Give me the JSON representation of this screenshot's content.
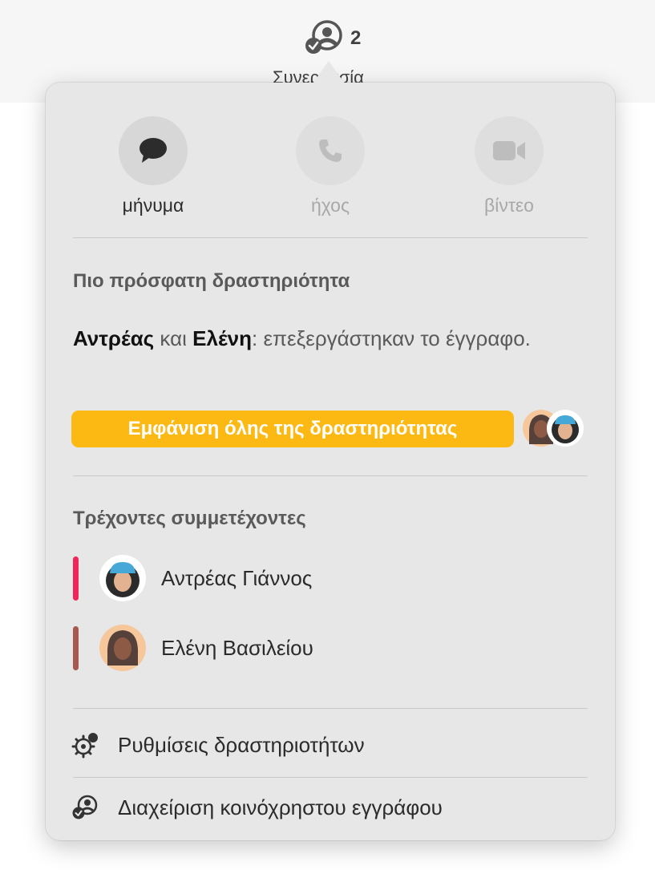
{
  "toolbar": {
    "collaborator_count": "2",
    "collab_label": "Συνεργασία"
  },
  "communication": {
    "message_label": "μήνυμα",
    "audio_label": "ήχος",
    "video_label": "βίντεο"
  },
  "recent_activity": {
    "title": "Πιο πρόσφατη δραστηριότητα",
    "name1": "Αντρέας",
    "conjunction": " και ",
    "name2": "Ελένη",
    "rest": ": επεξεργάστηκαν το έγγραφο.",
    "show_all_label": "Εμφάνιση όλης της δραστηριότητας"
  },
  "participants": {
    "title": "Τρέχοντες συμμετέχοντες",
    "items": [
      {
        "name": "Αντρέας Γιάννος",
        "color": "#f0255a"
      },
      {
        "name": "Ελένη Βασιλείου",
        "color": "#a65a4d"
      }
    ]
  },
  "menu": {
    "activity_settings": "Ρυθμίσεις δραστηριοτήτων",
    "manage_shared": "Διαχείριση κοινόχρηστου εγγράφου"
  },
  "colors": {
    "accent_button": "#fcb913",
    "popover_bg": "#e7e7e7"
  },
  "icons": {
    "collab": "collaboration-icon",
    "message": "speech-bubble-icon",
    "audio": "phone-icon",
    "video": "video-camera-icon",
    "settings": "gear-badge-icon",
    "manage": "shared-document-icon"
  }
}
